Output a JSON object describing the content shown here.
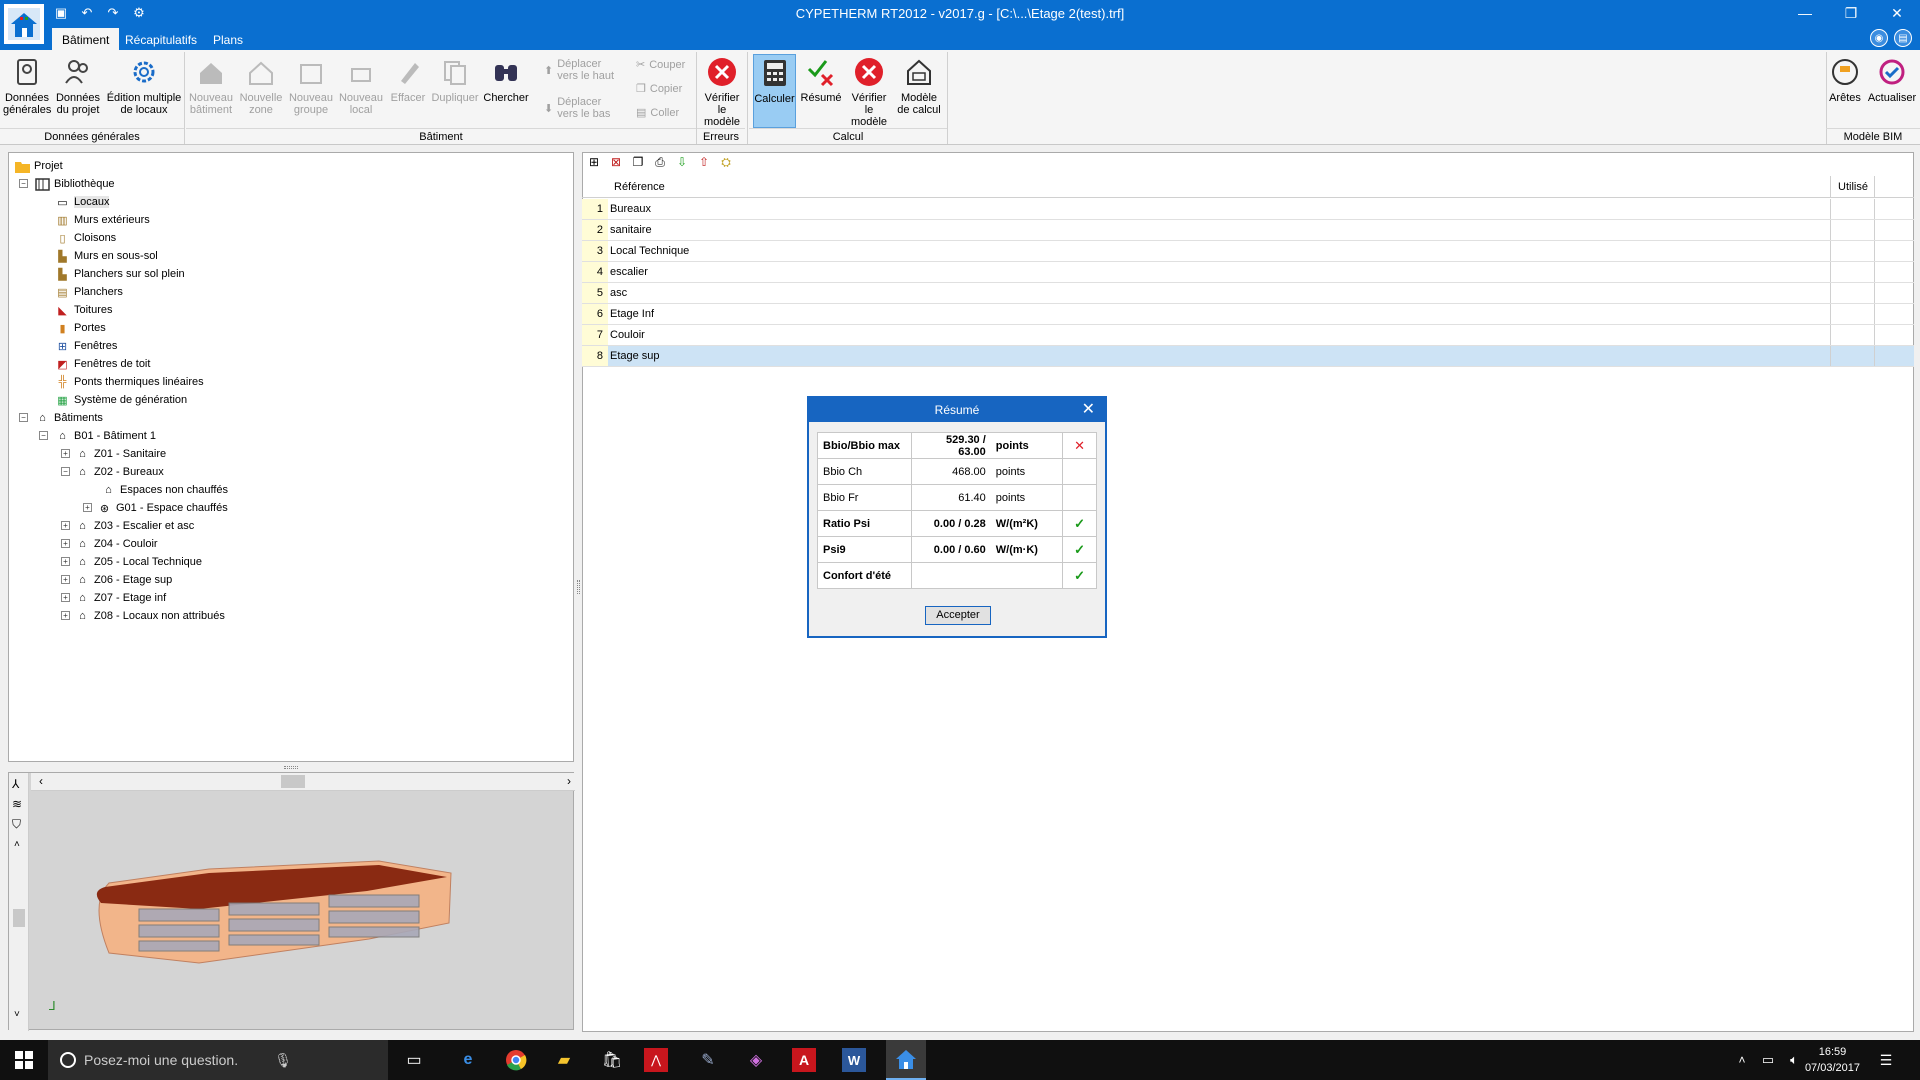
{
  "window": {
    "title": "CYPETHERM RT2012 - v2017.g - [C:\\...\\Etage 2(test).trf]"
  },
  "tabs": [
    "Bâtiment",
    "Récapitulatifs",
    "Plans"
  ],
  "ribbon": {
    "donnees_generales": "Données\ngénérales",
    "donnees_projet": "Données\ndu projet",
    "edition_multiple": "Édition multiple\nde locaux",
    "nouveau_batiment": "Nouveau\nbâtiment",
    "nouvelle_zone": "Nouvelle\nzone",
    "nouveau_groupe": "Nouveau\ngroupe",
    "nouveau_local": "Nouveau\nlocal",
    "effacer": "Effacer",
    "dupliquer": "Dupliquer",
    "chercher": "Chercher",
    "deplacer_haut": "Déplacer\nvers le haut",
    "deplacer_bas": "Déplacer\nvers le bas",
    "couper": "Couper",
    "copier": "Copier",
    "coller": "Coller",
    "verifier_modele_err": "Vérifier le\nmodèle",
    "calculer": "Calculer",
    "resume": "Résumé",
    "verifier_modele_calc": "Vérifier le\nmodèle",
    "modele_calcul": "Modèle\nde calcul",
    "aretes": "Arêtes",
    "actualiser": "Actualiser",
    "groups": {
      "donnees_generales": "Données générales",
      "batiment": "Bâtiment",
      "erreurs": "Erreurs",
      "calcul": "Calcul",
      "modele_bim": "Modèle BIM"
    }
  },
  "tree": {
    "projet": "Projet",
    "bibliotheque": "Bibliothèque",
    "library_items": [
      "Locaux",
      "Murs extérieurs",
      "Cloisons",
      "Murs en sous-sol",
      "Planchers sur sol plein",
      "Planchers",
      "Toitures",
      "Portes",
      "Fenêtres",
      "Fenêtres de toit",
      "Ponts thermiques linéaires",
      "Système de génération"
    ],
    "batiments": "Bâtiments",
    "b01": "B01 - Bâtiment 1",
    "z01": "Z01 - Sanitaire",
    "z02": "Z02 - Bureaux",
    "espaces_non_chauffes": "Espaces non chauffés",
    "g01": "G01 - Espace chauffés",
    "zones": [
      "Z03 - Escalier et asc",
      "Z04 - Couloir",
      "Z05 - Local Technique",
      "Z06 - Etage sup",
      "Z07 - Etage inf",
      "Z08 - Locaux non attribués"
    ]
  },
  "grid": {
    "header": {
      "reference": "Référence",
      "utilise": "Utilisé"
    },
    "rows": [
      {
        "num": "1",
        "ref": "Bureaux"
      },
      {
        "num": "2",
        "ref": "sanitaire"
      },
      {
        "num": "3",
        "ref": "Local Technique"
      },
      {
        "num": "4",
        "ref": "escalier"
      },
      {
        "num": "5",
        "ref": "asc"
      },
      {
        "num": "6",
        "ref": "Etage Inf"
      },
      {
        "num": "7",
        "ref": "Couloir"
      },
      {
        "num": "8",
        "ref": "Etage sup"
      }
    ]
  },
  "dialog": {
    "title": "Résumé",
    "rows": [
      {
        "label": "Bbio/Bbio max",
        "value": "529.30 / 63.00",
        "unit": "points",
        "status": "✕"
      },
      {
        "label": "Bbio Ch",
        "value": "468.00",
        "unit": "points",
        "status": ""
      },
      {
        "label": "Bbio Fr",
        "value": "61.40",
        "unit": "points",
        "status": ""
      },
      {
        "label": "Ratio Psi",
        "value": "0.00 / 0.28",
        "unit": "W/(m²K)",
        "status": "✓"
      },
      {
        "label": "Psi9",
        "value": "0.00 / 0.60",
        "unit": "W/(m·K)",
        "status": "✓"
      },
      {
        "label": "Confort d'été",
        "value": "",
        "unit": "",
        "status": "✓"
      }
    ],
    "accept": "Accepter"
  },
  "taskbar": {
    "search_placeholder": "Posez-moi une question.",
    "time": "16:59",
    "date": "07/03/2017"
  },
  "colors": {
    "titlebar": "#0a6fd0",
    "accent": "#1765c1",
    "error": "#e0202a",
    "ok": "#1a9a1a"
  }
}
